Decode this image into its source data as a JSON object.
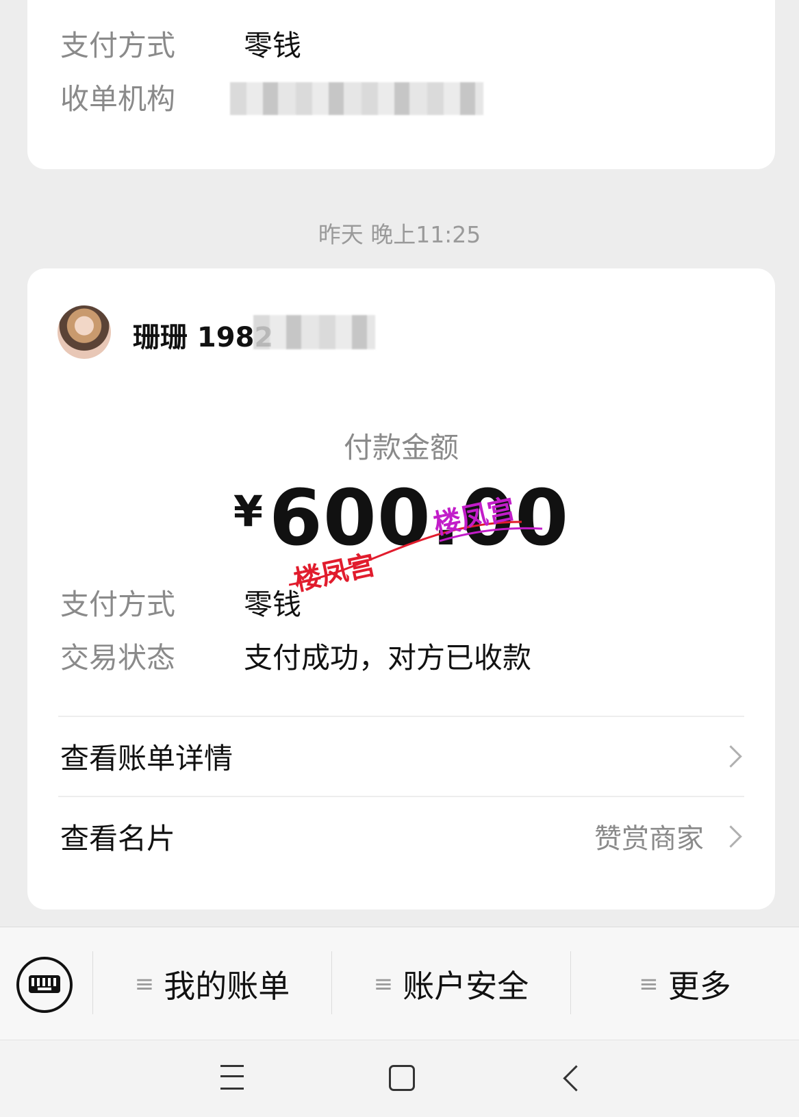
{
  "top_card": {
    "rows": [
      {
        "label": "支付方式",
        "value": "零钱"
      },
      {
        "label": "收单机构",
        "value": ""
      }
    ]
  },
  "timestamp": "昨天 晚上11:25",
  "payment_card": {
    "user_name": "珊珊 1982",
    "amount_label": "付款金额",
    "currency": "¥",
    "amount": "600.00",
    "watermark": "楼凤宫",
    "rows": [
      {
        "label": "支付方式",
        "value": "零钱"
      },
      {
        "label": "交易状态",
        "value": "支付成功，对方已收款"
      }
    ],
    "links": [
      {
        "label": "查看账单详情",
        "extra": ""
      },
      {
        "label": "查看名片",
        "extra": "赞赏商家"
      }
    ]
  },
  "bottom_menu": {
    "items": [
      {
        "label": "我的账单",
        "icon": "hamburger-icon"
      },
      {
        "label": "账户安全",
        "icon": "hamburger-icon"
      },
      {
        "label": "更多",
        "icon": "hamburger-icon"
      }
    ]
  }
}
